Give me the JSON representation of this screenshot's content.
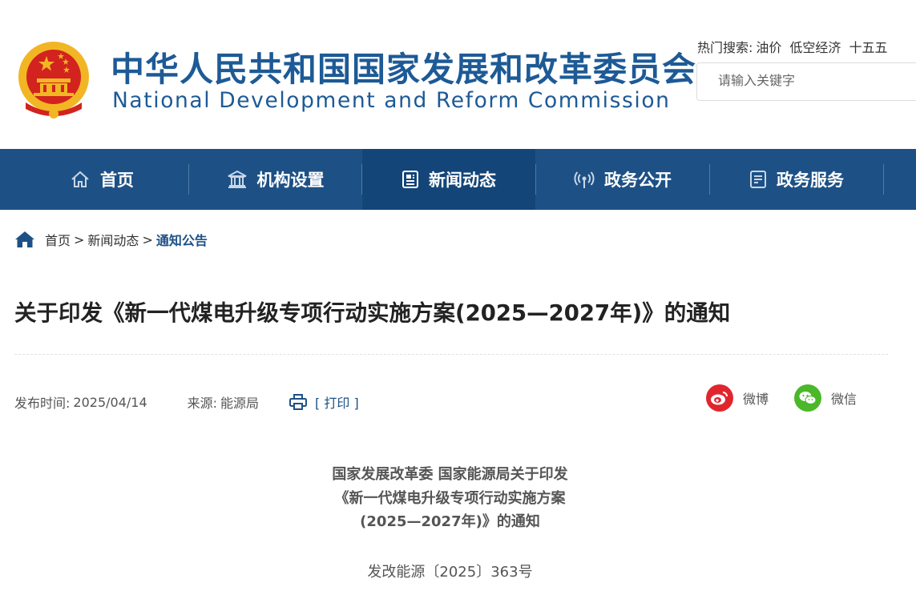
{
  "header": {
    "title_cn": "中华人民共和国国家发展和改革委员会",
    "title_en": "National Development and Reform Commission",
    "hot_search_label": "热门搜索:",
    "hot_search_terms": [
      "油价",
      "低空经济",
      "十五五"
    ],
    "search_placeholder": "请输入关键字"
  },
  "nav": {
    "items": [
      {
        "label": "首页",
        "icon": "home-icon"
      },
      {
        "label": "机构设置",
        "icon": "institution-icon"
      },
      {
        "label": "新闻动态",
        "icon": "news-icon",
        "active": true
      },
      {
        "label": "政务公开",
        "icon": "broadcast-icon"
      },
      {
        "label": "政务服务",
        "icon": "service-icon"
      }
    ]
  },
  "breadcrumb": {
    "home": "首页",
    "sep": ">",
    "level1": "新闻动态",
    "current": "通知公告"
  },
  "article": {
    "title": "关于印发《新一代煤电升级专项行动实施方案(2025—2027年)》的通知",
    "publish_label": "发布时间:",
    "publish_date": "2025/04/14",
    "source_label": "来源:",
    "source": "能源局",
    "print_label": "[ 打印 ]",
    "share": {
      "weibo": "微博",
      "wechat": "微信"
    },
    "heading_lines": [
      "国家发展改革委 国家能源局关于印发",
      "《新一代煤电升级专项行动实施方案",
      "(2025—2027年)》的通知"
    ],
    "doc_number": "发改能源〔2025〕363号"
  },
  "colors": {
    "brand_blue": "#1d5186",
    "nav_active": "#134578",
    "weibo_red": "#e0262d",
    "wechat_green": "#4ab829",
    "emblem_red": "#d2231e",
    "emblem_gold": "#f2b624"
  }
}
